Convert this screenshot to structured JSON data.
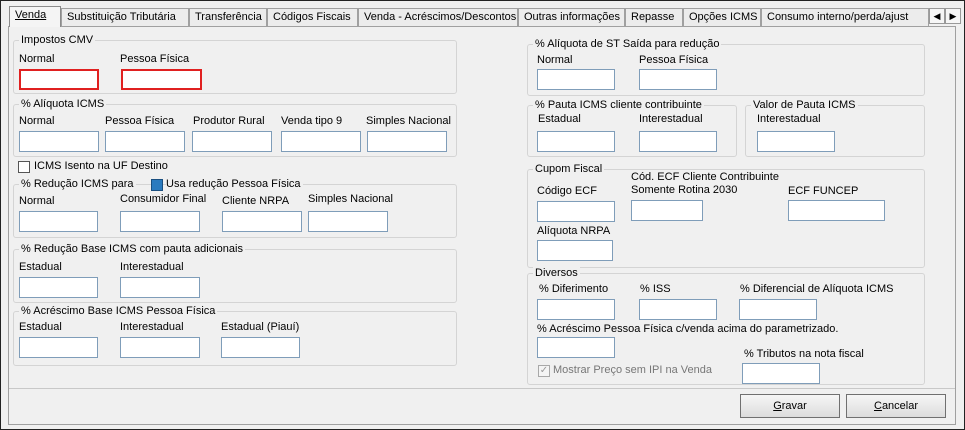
{
  "tabs": [
    {
      "label": "Venda",
      "active": true
    },
    {
      "label": "Substituição Tributária"
    },
    {
      "label": "Transferência"
    },
    {
      "label": "Códigos Fiscais"
    },
    {
      "label": "Venda - Acréscimos/Descontos"
    },
    {
      "label": "Outras informações"
    },
    {
      "label": "Repasse"
    },
    {
      "label": "Opções ICMS"
    },
    {
      "label": "Consumo interno/perda/ajust"
    }
  ],
  "impostos_cmv": {
    "title": "Impostos CMV",
    "normal": "Normal",
    "pessoa_fisica": "Pessoa Física"
  },
  "aliquota_icms": {
    "title": "% Alíquota ICMS",
    "normal": "Normal",
    "pessoa_fisica": "Pessoa Física",
    "produtor_rural": "Produtor Rural",
    "venda_tipo9": "Venda tipo 9",
    "simples_nacional": "Simples Nacional"
  },
  "icms_isento": "ICMS Isento na UF Destino",
  "reducao_icms": {
    "title": "% Redução ICMS para",
    "usa_reducao": "Usa redução Pessoa Física",
    "normal": "Normal",
    "consumidor_final": "Consumidor Final",
    "cliente_nrpa": "Cliente NRPA",
    "simples_nacional": "Simples Nacional"
  },
  "reducao_base": {
    "title": "% Redução Base ICMS com pauta adicionais",
    "estadual": "Estadual",
    "interestadual": "Interestadual"
  },
  "acrescimo_base": {
    "title": "% Acréscimo Base ICMS Pessoa Física",
    "estadual": "Estadual",
    "interestadual": "Interestadual",
    "estadual_piaui": "Estadual (Piauí)"
  },
  "aliquota_st": {
    "title": "% Alíquota de ST Saída para redução",
    "normal": "Normal",
    "pessoa_fisica": "Pessoa Física"
  },
  "pauta_icms": {
    "title": "% Pauta ICMS cliente contribuinte",
    "estadual": "Estadual",
    "interestadual": "Interestadual"
  },
  "valor_pauta": {
    "title": "Valor de Pauta ICMS",
    "interestadual": "Interestadual"
  },
  "cupom_fiscal": {
    "title": "Cupom Fiscal",
    "codigo_ecf": "Código ECF",
    "cod_ecf_cliente_line1": "Cód. ECF Cliente Contribuinte",
    "cod_ecf_cliente_line2": "Somente Rotina 2030",
    "ecf_funcep": "ECF FUNCEP",
    "aliquota_nrpa": "Alíquota NRPA"
  },
  "diversos": {
    "title": "Diversos",
    "diferimento": "% Diferimento",
    "iss": "% ISS",
    "diferencial": "% Diferencial de Alíquota ICMS",
    "acrescimo_pf": "% Acréscimo Pessoa Física c/venda acima do parametrizado.",
    "tributos": "% Tributos na nota fiscal",
    "mostrar_preco": "Mostrar Preço sem IPI na Venda"
  },
  "buttons": {
    "gravar_underlined": "G",
    "gravar_rest": "ravar",
    "cancelar_underlined": "C",
    "cancelar_rest": "ancelar"
  }
}
